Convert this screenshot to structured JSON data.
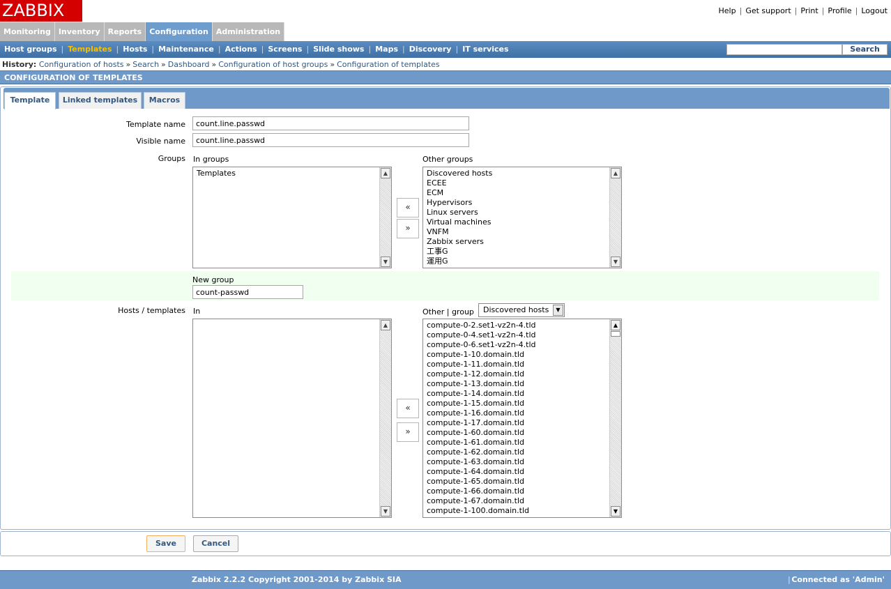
{
  "logo": "ZABBIX",
  "top_links": [
    "Help",
    "Get support",
    "Print",
    "Profile",
    "Logout"
  ],
  "main_menu": [
    {
      "label": "Monitoring",
      "active": false
    },
    {
      "label": "Inventory",
      "active": false
    },
    {
      "label": "Reports",
      "active": false
    },
    {
      "label": "Configuration",
      "active": true
    },
    {
      "label": "Administration",
      "active": false
    }
  ],
  "sub_menu": [
    {
      "label": "Host groups",
      "active": false
    },
    {
      "label": "Templates",
      "active": true
    },
    {
      "label": "Hosts",
      "active": false
    },
    {
      "label": "Maintenance",
      "active": false
    },
    {
      "label": "Actions",
      "active": false
    },
    {
      "label": "Screens",
      "active": false
    },
    {
      "label": "Slide shows",
      "active": false
    },
    {
      "label": "Maps",
      "active": false
    },
    {
      "label": "Discovery",
      "active": false
    },
    {
      "label": "IT services",
      "active": false
    }
  ],
  "search": {
    "value": "",
    "button_label": "Search"
  },
  "history": {
    "label": "History:",
    "items": [
      "Configuration of hosts",
      "Search",
      "Dashboard",
      "Configuration of host groups",
      "Configuration of templates"
    ],
    "separator": "»"
  },
  "page_title": "CONFIGURATION OF TEMPLATES",
  "tabs": [
    {
      "label": "Template",
      "active": true
    },
    {
      "label": "Linked templates",
      "active": false
    },
    {
      "label": "Macros",
      "active": false
    }
  ],
  "form": {
    "template_name_label": "Template name",
    "template_name_value": "count.line.passwd",
    "visible_name_label": "Visible name",
    "visible_name_value": "count.line.passwd",
    "groups_label": "Groups",
    "in_groups_label": "In groups",
    "other_groups_label": "Other groups",
    "in_groups": [
      "Templates"
    ],
    "other_groups": [
      "Discovered hosts",
      "ECEE",
      "ECM",
      "Hypervisors",
      "Linux servers",
      "Virtual machines",
      "VNFM",
      "Zabbix servers",
      "工事G",
      "運用G"
    ],
    "move_left": "«",
    "move_right": "»",
    "new_group_label": "New group",
    "new_group_value": "count-passwd",
    "hosts_templates_label": "Hosts / templates",
    "in_label": "In",
    "other_label": "Other",
    "group_sep": "|",
    "group_label": "group",
    "group_select_value": "Discovered hosts",
    "in_hosts": [],
    "other_hosts": [
      "compute-0-2.set1-vz2n-4.tld",
      "compute-0-4.set1-vz2n-4.tld",
      "compute-0-6.set1-vz2n-4.tld",
      "compute-1-10.domain.tld",
      "compute-1-11.domain.tld",
      "compute-1-12.domain.tld",
      "compute-1-13.domain.tld",
      "compute-1-14.domain.tld",
      "compute-1-15.domain.tld",
      "compute-1-16.domain.tld",
      "compute-1-17.domain.tld",
      "compute-1-60.domain.tld",
      "compute-1-61.domain.tld",
      "compute-1-62.domain.tld",
      "compute-1-63.domain.tld",
      "compute-1-64.domain.tld",
      "compute-1-65.domain.tld",
      "compute-1-66.domain.tld",
      "compute-1-67.domain.tld",
      "compute-1-100.domain.tld"
    ],
    "save_label": "Save",
    "cancel_label": "Cancel"
  },
  "footer": {
    "copyright": "Zabbix 2.2.2 Copyright 2001-2014 by Zabbix SIA",
    "separator": "|",
    "connected": "Connected as 'Admin'"
  },
  "icons": {
    "scroll_up": "▲",
    "scroll_down": "▼",
    "dropdown": "▼"
  },
  "colors": {
    "logo_bg": "#d40000",
    "active_menu": "#6e9ccd",
    "active_submenu_text": "#f6c000",
    "header_blue": "#6f99c8",
    "new_group_bg": "#f0fff0"
  }
}
